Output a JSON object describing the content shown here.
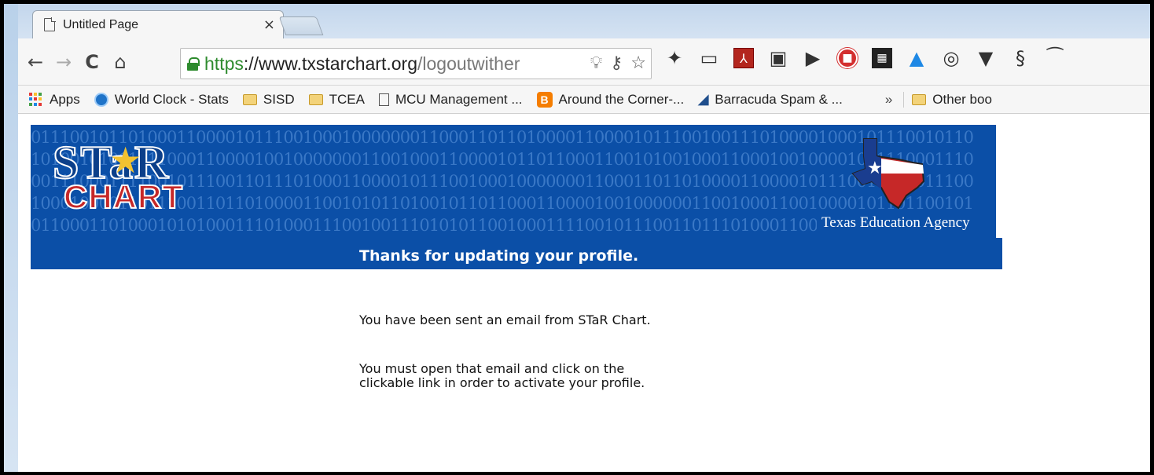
{
  "browser": {
    "tab_title": "Untitled Page",
    "tab_close": "×",
    "url_scheme": "https",
    "url_host": "://www.txstarchart.org",
    "url_path": "/logoutwither",
    "bookmarks": [
      {
        "label": "Apps",
        "icon": "apps-grid-icon"
      },
      {
        "label": "World Clock - Stats",
        "icon": "clock-icon"
      },
      {
        "label": "SISD",
        "icon": "folder-icon"
      },
      {
        "label": "TCEA",
        "icon": "folder-icon"
      },
      {
        "label": "MCU Management ...",
        "icon": "page-icon"
      },
      {
        "label": "Around the Corner-...",
        "icon": "blogger-icon"
      },
      {
        "label": "Barracuda Spam & ...",
        "icon": "barracuda-icon"
      },
      {
        "label": "Other boo",
        "icon": "folder-icon"
      }
    ],
    "overflow_chevron": "»"
  },
  "banner": {
    "logo_top": "STaR",
    "logo_bottom": "CHART",
    "agency": "Texas Education Agency",
    "headline": "Thanks for updating  your profile."
  },
  "content": {
    "message_1": "You have been sent an email from STaR Chart.",
    "message_2": "You must open that email and click on the clickable link in order to activate your profile."
  },
  "colors": {
    "banner_blue": "#0b4fa7",
    "secure_green": "#2e8b2e"
  }
}
